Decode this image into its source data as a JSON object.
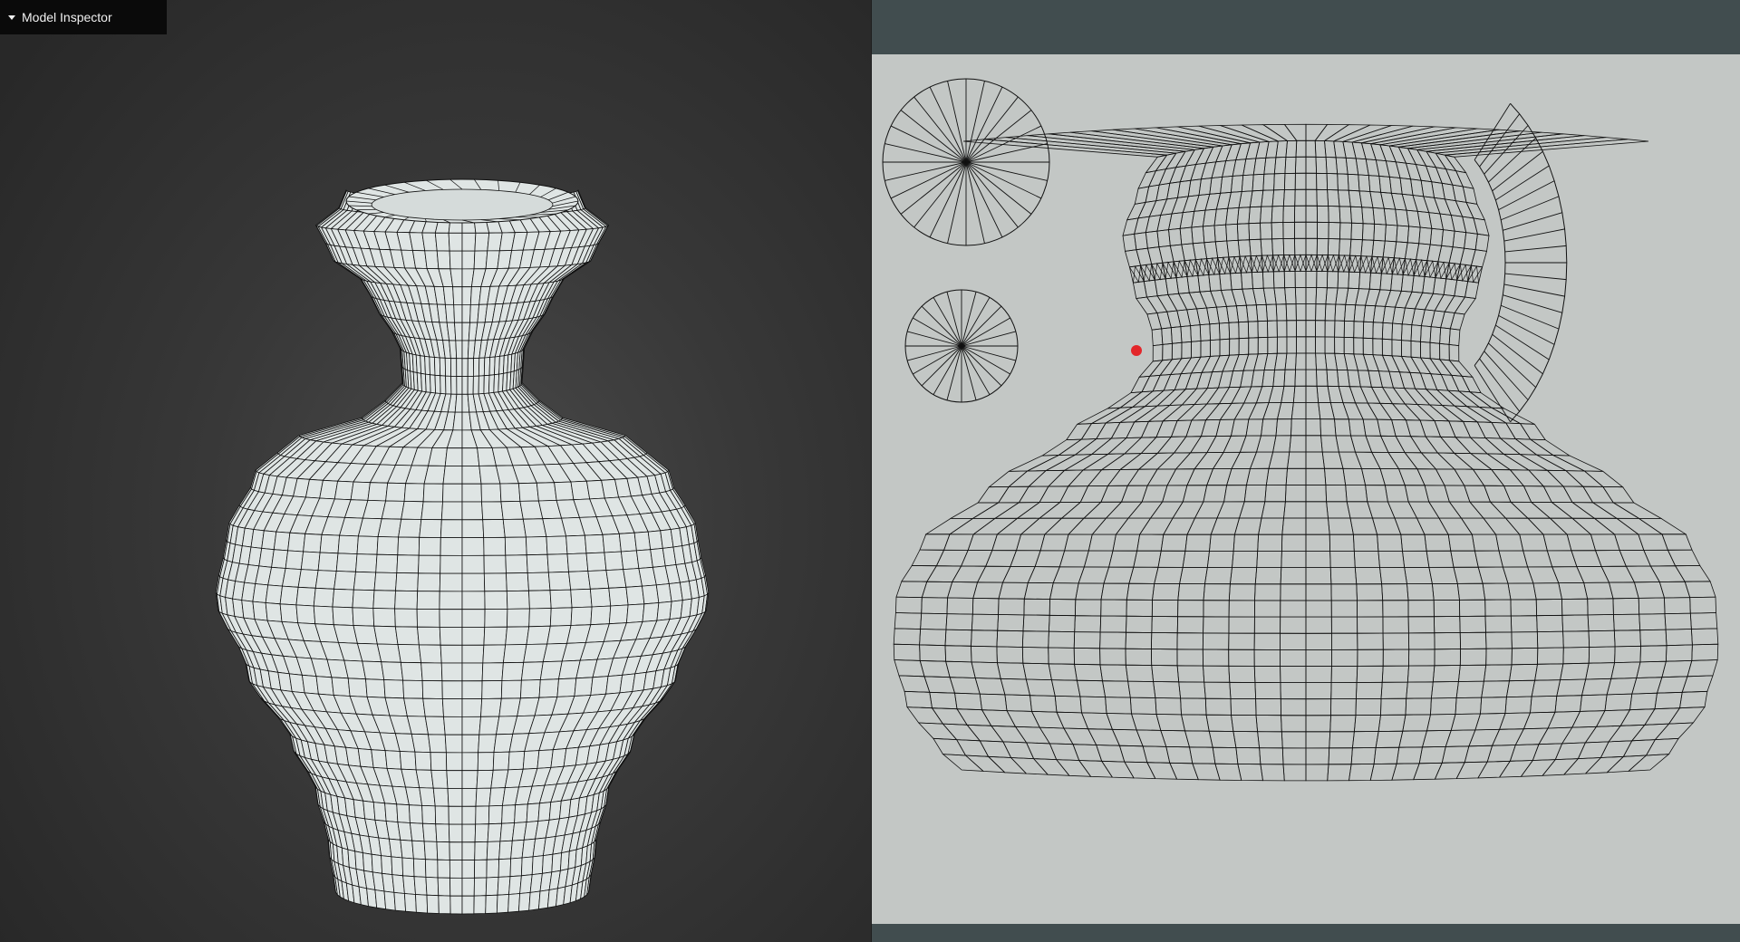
{
  "panel": {
    "title": "Model Inspector",
    "toggle_icon": "caret-down-icon"
  },
  "viewport": {
    "background_color": "#383838",
    "mesh_color": "#dfe5e4",
    "wire_color": "#111111"
  },
  "uv_editor": {
    "background_color": "#414d4f",
    "canvas_color": "#c3c7c5",
    "selection_marker_color": "#e3262a",
    "islands": [
      "body-island",
      "neck-ring-island",
      "lip-island",
      "top-cap-island",
      "bottom-cap-island"
    ]
  }
}
